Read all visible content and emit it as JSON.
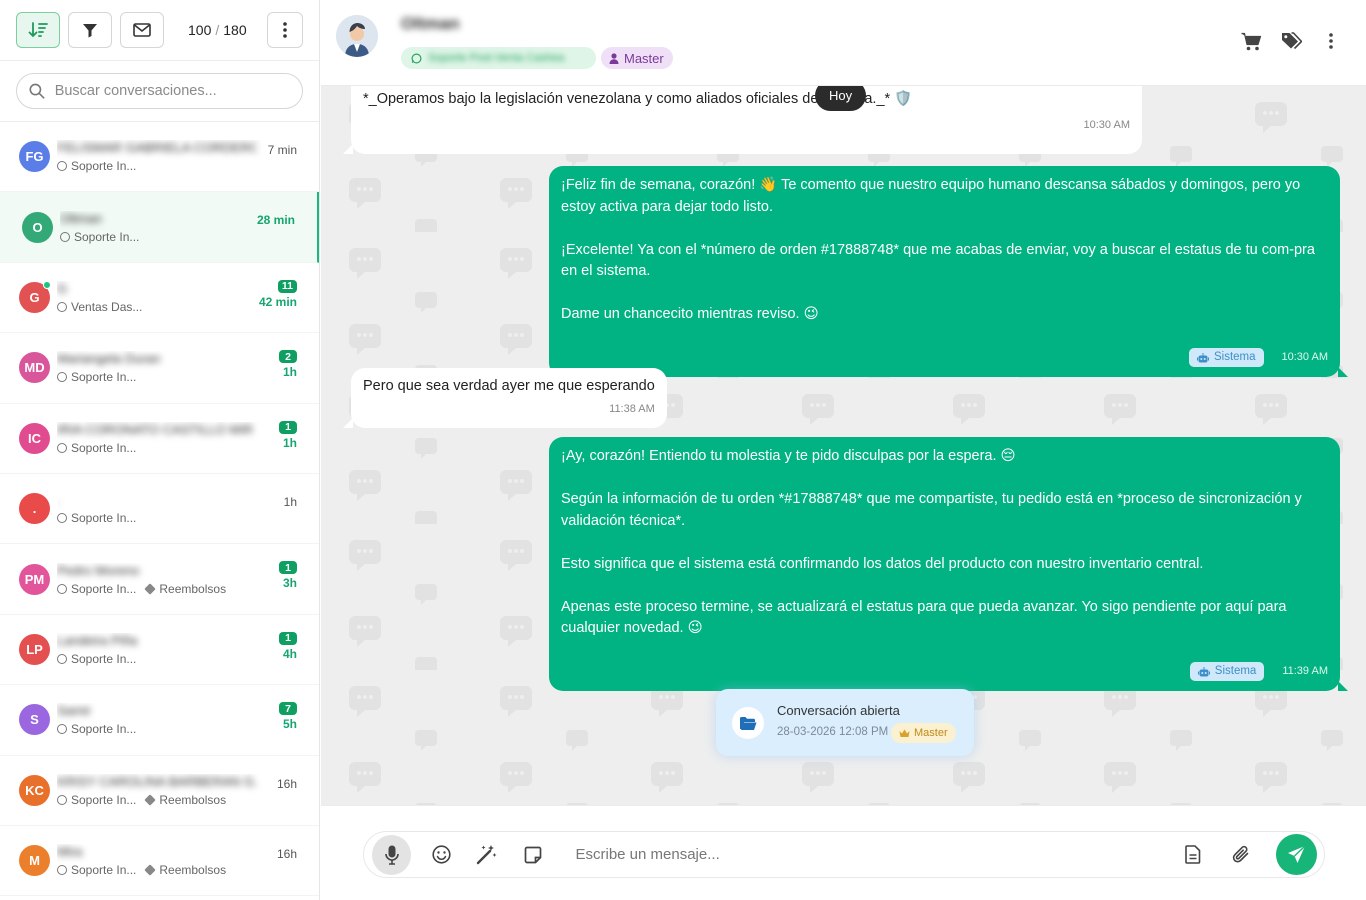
{
  "toolbar": {
    "count_current": "100",
    "count_separator": "/",
    "count_total": "180"
  },
  "search": {
    "placeholder": "Buscar conversaciones..."
  },
  "conversations": [
    {
      "initials": "FG",
      "color": "#5b7de8",
      "name": "FELISMAR GABRIELA CORDERO",
      "channel": "Soporte In...",
      "tag": "",
      "time": "7 min",
      "unread": "",
      "online": false,
      "active": false
    },
    {
      "initials": "O",
      "color": "#34a978",
      "name": "Oltman",
      "channel": "Soporte In...",
      "tag": "",
      "time": "28 min",
      "unread": "",
      "online": false,
      "active": true
    },
    {
      "initials": "G",
      "color": "#e25252",
      "name": "G",
      "channel": "Ventas Das...",
      "tag": "",
      "time": "42 min",
      "unread": "11",
      "online": true,
      "active": false
    },
    {
      "initials": "MD",
      "color": "#d9569a",
      "name": "Mariangela Duran",
      "channel": "Soporte In...",
      "tag": "",
      "time": "1h",
      "unread": "2",
      "online": false,
      "active": false
    },
    {
      "initials": "IC",
      "color": "#e04c8f",
      "name": "IRIA CORONATO CASTILLO MIR",
      "channel": "Soporte In...",
      "tag": "",
      "time": "1h",
      "unread": "1",
      "online": false,
      "active": false
    },
    {
      "initials": ".",
      "color": "#e94a4a",
      "name": ".",
      "channel": "Soporte In...",
      "tag": "",
      "time": "1h",
      "unread": "",
      "online": false,
      "active": false
    },
    {
      "initials": "PM",
      "color": "#e2559a",
      "name": "Pedro Moreno",
      "channel": "Soporte In...",
      "tag": "Reembolsos",
      "time": "3h",
      "unread": "1",
      "online": false,
      "active": false
    },
    {
      "initials": "LP",
      "color": "#e44f4f",
      "name": "Landeira Piña",
      "channel": "Soporte In...",
      "tag": "",
      "time": "4h",
      "unread": "1",
      "online": false,
      "active": false
    },
    {
      "initials": "S",
      "color": "#9b67e0",
      "name": "Samir",
      "channel": "Soporte In...",
      "tag": "",
      "time": "5h",
      "unread": "7",
      "online": false,
      "active": false
    },
    {
      "initials": "KC",
      "color": "#e8702a",
      "name": "KRISY CAROLINA BARBERAN G.",
      "channel": "Soporte In...",
      "tag": "Reembolsos",
      "time": "16h",
      "unread": "",
      "online": false,
      "active": false
    },
    {
      "initials": "M",
      "color": "#ec7f2c",
      "name": "Mira",
      "channel": "Soporte In...",
      "tag": "Reembolsos",
      "time": "16h",
      "unread": "",
      "online": false,
      "active": false
    }
  ],
  "header": {
    "name": "Oltman",
    "channel_chip": "Soporte Post-Venta Cashea",
    "role_chip": "Master"
  },
  "chat": {
    "day_separator": "Hoy",
    "messages": [
      {
        "dir": "in",
        "paragraphs": [
          "*_Operamos bajo la legislación venezolana y como aliados oficiales de Cashea._* 🛡️"
        ],
        "time": "10:30 AM",
        "tag": ""
      },
      {
        "dir": "out",
        "paragraphs": [
          "¡Feliz fin de semana, corazón! 👋 Te comento que nuestro equipo humano descansa sábados y domingos, pero yo estoy activa para dejar todo listo.",
          "¡Excelente! Ya con el *número de orden #17888748* que me acabas de enviar, voy a buscar el estatus de tu com-pra en el sistema.",
          "Dame un chancecito mientras reviso. 😉"
        ],
        "time": "10:30 AM",
        "tag": "Sistema"
      },
      {
        "dir": "in",
        "paragraphs": [
          "Pero que sea verdad ayer me que esperando"
        ],
        "time": "11:38 AM",
        "tag": ""
      },
      {
        "dir": "out",
        "paragraphs": [
          "¡Ay, corazón! Entiendo tu molestia y te pido disculpas por la espera. 😔",
          "Según la información de tu orden *#17888748* que me compartiste, tu pedido está en *proceso de sincronización y validación técnica*.",
          "Esto significa que el sistema está confirmando los datos del producto con nuestro inventario central.",
          "Apenas este proceso termine, se actualizará el estatus para que pueda avanzar. Yo sigo pendiente por aquí para cualquier novedad. 😉"
        ],
        "time": "11:39 AM",
        "tag": "Sistema"
      }
    ],
    "event": {
      "title": "Conversación abierta",
      "date": "28-03-2026 12:08 PM",
      "role": "Master"
    }
  },
  "composer": {
    "placeholder": "Escribe un mensaje..."
  },
  "colors": {
    "accent": "#01b382",
    "send": "#17b577",
    "system_chip": "#cfe9fa",
    "master_chip": "#efe0f7"
  },
  "icons": [
    "sort-icon",
    "filter-icon",
    "mail-icon",
    "kebab-icon",
    "search-icon",
    "whatsapp-icon",
    "tag-icon",
    "cart-icon",
    "tags-icon",
    "robot-icon",
    "folder-open-icon",
    "crown-icon",
    "mic-icon",
    "emoji-icon",
    "magic-wand-icon",
    "note-icon",
    "document-icon",
    "paperclip-icon",
    "send-icon"
  ]
}
